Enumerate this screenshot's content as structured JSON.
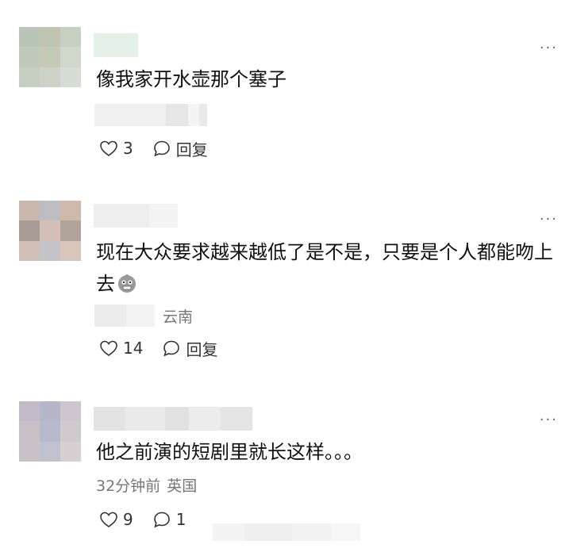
{
  "comments": [
    {
      "text": "像我家开水壶那个塞子",
      "likes": "3",
      "reply_label": "回复",
      "more": "···"
    },
    {
      "text": "现在大众要求越来越低了是不是，只要是个人都能吻上去",
      "location": "云南",
      "likes": "14",
      "reply_label": "回复",
      "more": "···",
      "emoji_icon": "grimace-face-icon"
    },
    {
      "text": "他之前演的短剧里就长这样。。。",
      "time": "32分钟前",
      "location": "英国",
      "likes": "9",
      "replies": "1",
      "more": "···"
    }
  ],
  "colors": {
    "text": "#111111",
    "meta": "#777777",
    "icon": "#333333"
  }
}
